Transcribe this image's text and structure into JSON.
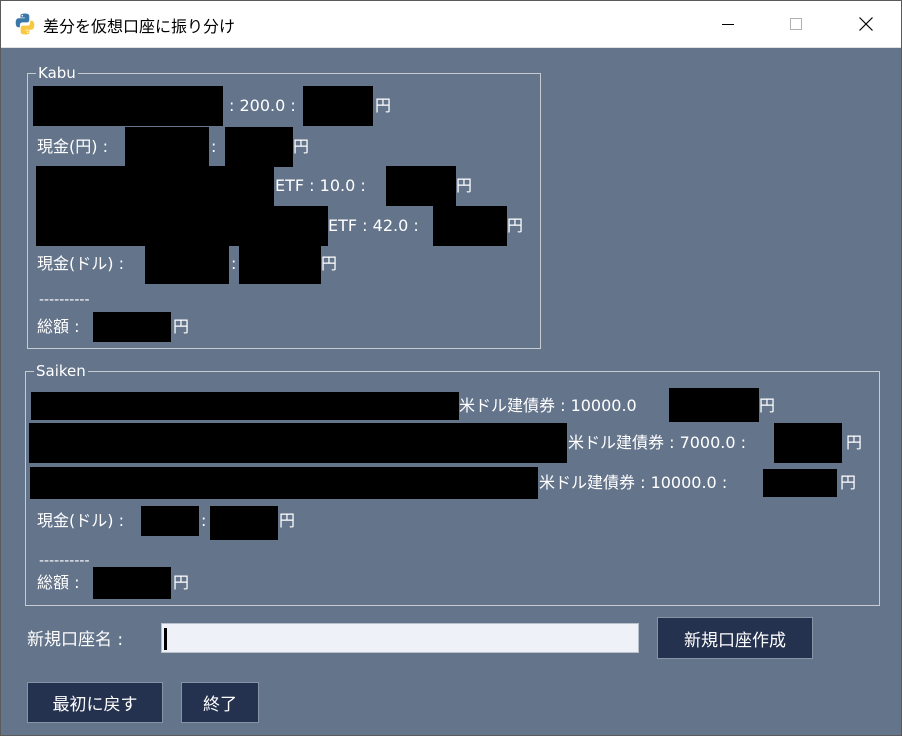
{
  "window": {
    "title": "差分を仮想口座に振り分け",
    "icon": "python-icon",
    "controls": [
      "minimize-icon",
      "maximize-icon",
      "close-icon"
    ]
  },
  "colors": {
    "background": "#64748b",
    "button": "#25324f",
    "redaction": "#000000",
    "input": "#eef2f8"
  },
  "kabu": {
    "title": "Kabu",
    "rows": [
      {
        "t1": ": 200.0 :",
        "t2": "円"
      },
      {
        "label": "現金(円) :",
        "t1": ":",
        "t2": "円"
      },
      {
        "t1": "ETF : 10.0 :",
        "t2": "円"
      },
      {
        "t1": "ETF : 42.0 :",
        "t2": "円"
      },
      {
        "label": "現金(ドル) :",
        "t1": ":",
        "t2": "円"
      }
    ],
    "separator": "----------",
    "total_label": "総額 :",
    "total_unit": "円"
  },
  "saiken": {
    "title": "Saiken",
    "rows": [
      {
        "t1": "米ドル建債券 : 10000.0",
        "t2": "円"
      },
      {
        "t1": "米ドル建債券 : 7000.0 :",
        "t2": "円"
      },
      {
        "t1": "米ドル建債券 : 10000.0 :",
        "t2": "円"
      },
      {
        "label": "現金(ドル) :",
        "t1": ":",
        "t2": "円"
      }
    ],
    "separator": "----------",
    "total_label": "総額 :",
    "total_unit": "円"
  },
  "form": {
    "new_account_label": "新規口座名 :",
    "new_account_value": "",
    "create_button": "新規口座作成"
  },
  "actions": {
    "reset_button": "最初に戻す",
    "exit_button": "終了"
  }
}
